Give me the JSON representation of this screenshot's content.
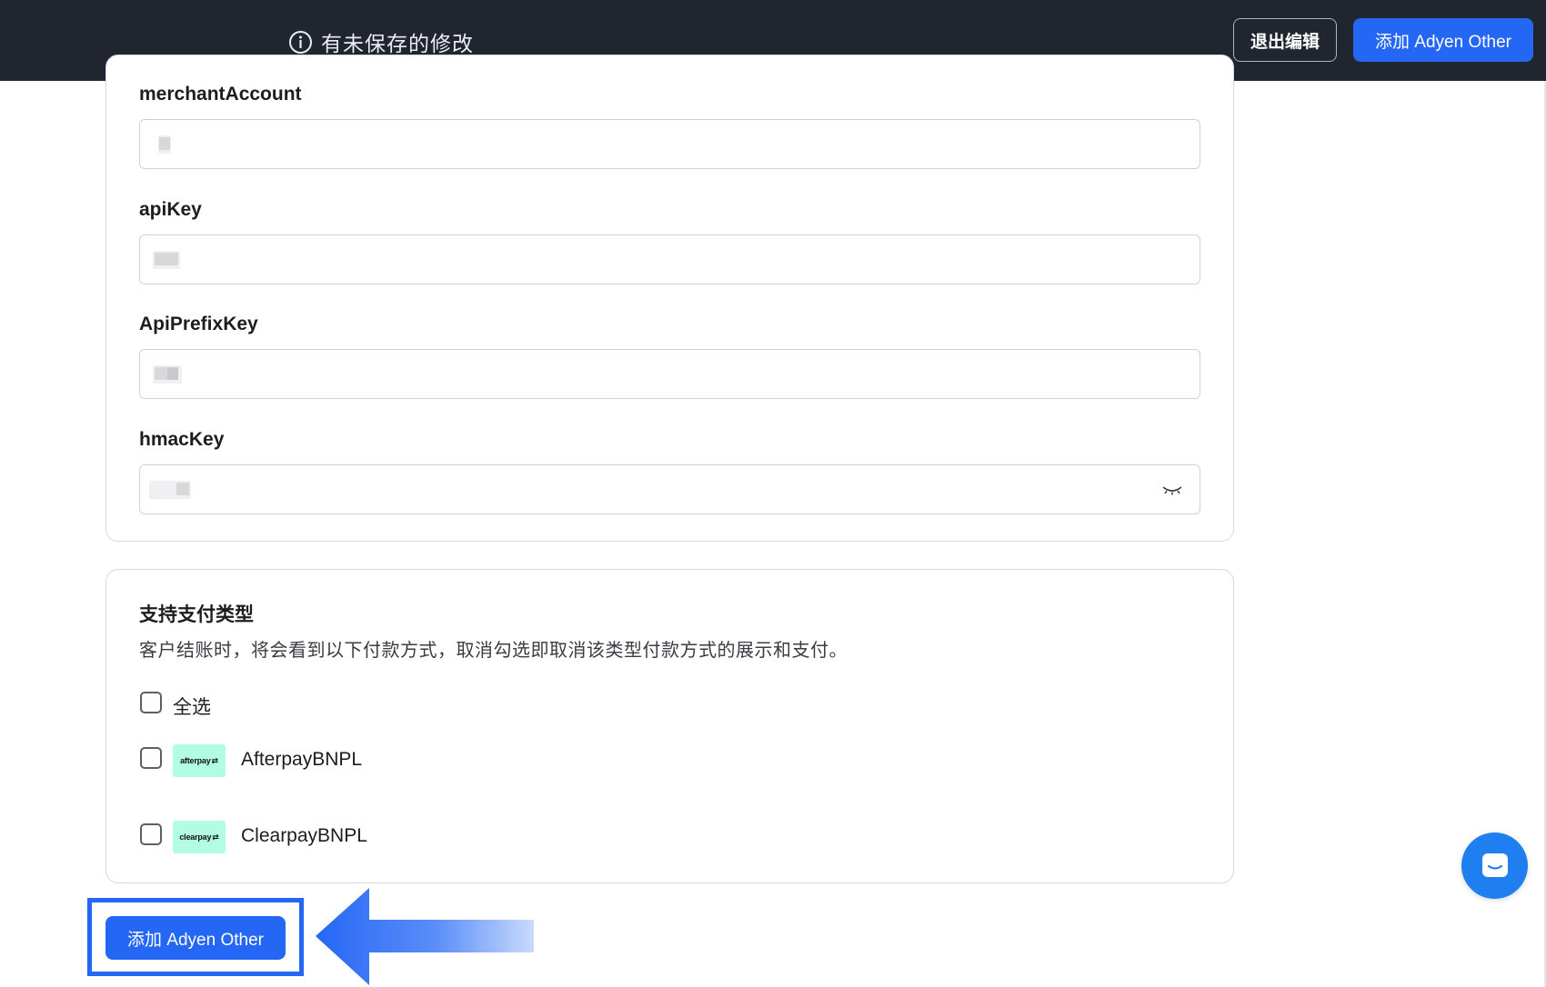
{
  "topbar": {
    "unsaved_text": "有未保存的修改",
    "exit_label": "退出编辑",
    "add_label": "添加 Adyen Other"
  },
  "fields": [
    {
      "label": "merchantAccount"
    },
    {
      "label": "apiKey"
    },
    {
      "label": "ApiPrefixKey"
    },
    {
      "label": "hmacKey"
    }
  ],
  "payment_types": {
    "title": "支持支付类型",
    "description": "客户结账时，将会看到以下付款方式，取消勾选即取消该类型付款方式的展示和支付。",
    "select_all_label": "全选",
    "methods": [
      {
        "name": "AfterpayBNPL",
        "logo_text": "afterpay",
        "checked": false
      },
      {
        "name": "ClearpayBNPL",
        "logo_text": "clearpay",
        "checked": false
      }
    ]
  },
  "footer": {
    "add_label": "添加 Adyen Other"
  },
  "colors": {
    "topbar_bg": "#212530",
    "primary": "#2567f5",
    "logo_bg": "#b2fce4",
    "chat": "#1f7ff0"
  }
}
